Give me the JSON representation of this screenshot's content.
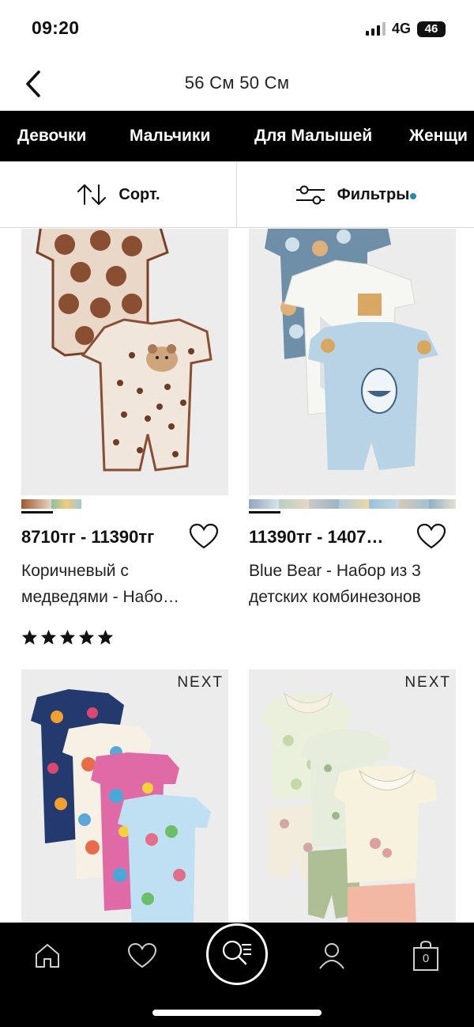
{
  "status": {
    "time": "09:20",
    "network": "4G",
    "battery": "46"
  },
  "header": {
    "title": "56 См 50 См"
  },
  "categories": [
    "Девочки",
    "Мальчики",
    "Для Малышей",
    "Женщи"
  ],
  "toolbar": {
    "sort_label": "Сорт.",
    "filter_label": "Фильтры"
  },
  "products": [
    {
      "price": "8710тг - 11390тг",
      "name_line1": "Коричневый с",
      "name_line2": "медведями - Набо…",
      "rating_stars": 5,
      "brand": ""
    },
    {
      "price": "11390тг - 1407…",
      "name_line1": "Blue Bear - Набор из 3",
      "name_line2": "детских комбинезонов",
      "brand": ""
    },
    {
      "brand": "NEXT"
    },
    {
      "brand": "NEXT"
    }
  ],
  "bottom_nav": {
    "items": [
      "home-icon",
      "heart-icon",
      "search-icon",
      "account-icon",
      "bag-icon"
    ],
    "bag_count": "0"
  },
  "colors": {
    "nav_bg": "#000000",
    "filter_dot": "#2b8aa8",
    "image_bg": "#ebebeb"
  }
}
